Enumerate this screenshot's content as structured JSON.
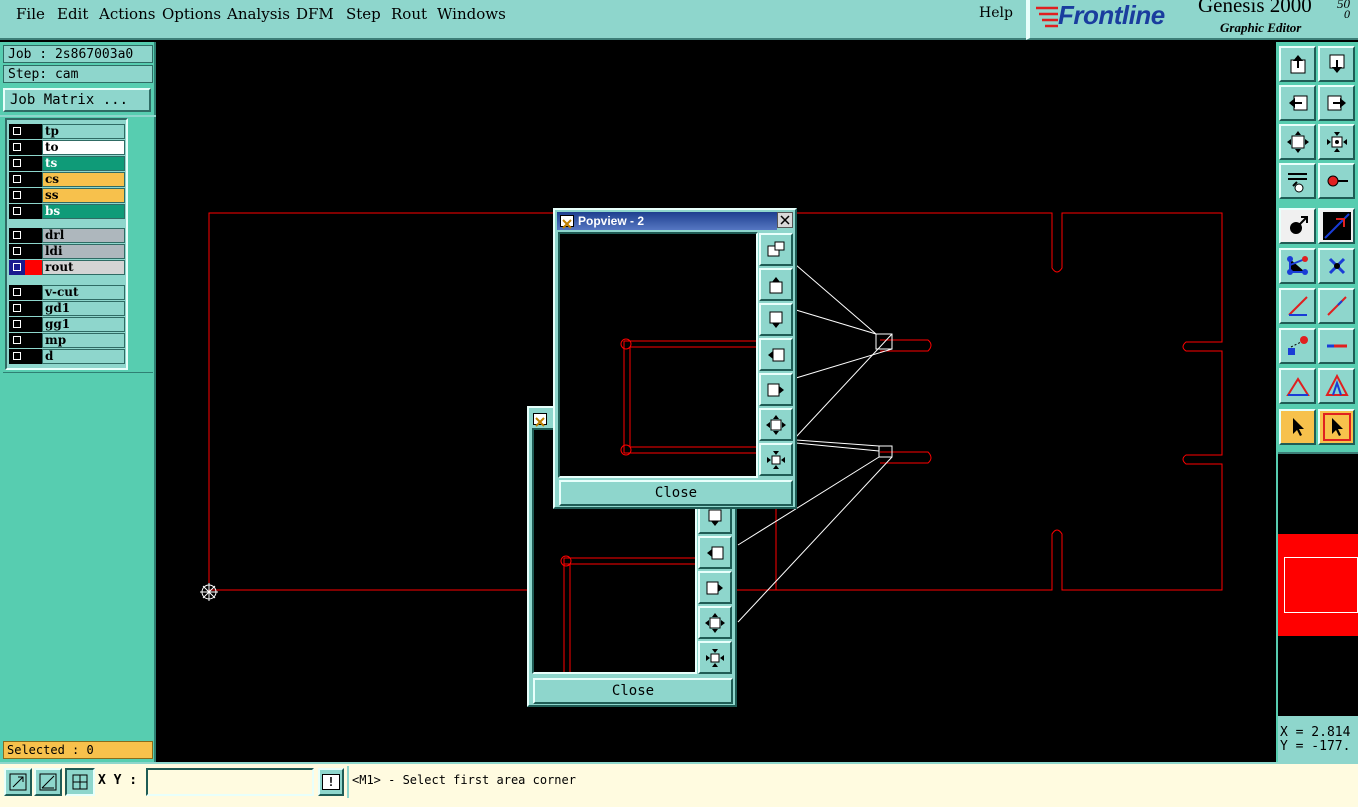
{
  "menu": {
    "items": [
      "File",
      "Edit",
      "Actions",
      "Options",
      "Analysis",
      "DFM",
      "Step",
      "Rout",
      "Windows"
    ],
    "help": "Help"
  },
  "brand": {
    "logo": "Frontline",
    "product": "Genesis 2000",
    "superscript": "50",
    "subtitle": "Graphic Editor",
    "corner": "0"
  },
  "left": {
    "job": "Job : 2s867003a0",
    "step": "Step: cam",
    "job_matrix": "Job Matrix ...",
    "layers": [
      {
        "name": "tp",
        "color": "#8ed6cc",
        "swatch": "#000000"
      },
      {
        "name": "to",
        "color": "#ffffff",
        "swatch": "#000000"
      },
      {
        "name": "ts",
        "color": "#0f9b78",
        "swatch": "#000000"
      },
      {
        "name": "cs",
        "color": "#f7c14c",
        "swatch": "#000000"
      },
      {
        "name": "ss",
        "color": "#f7c14c",
        "swatch": "#000000"
      },
      {
        "name": "bs",
        "color": "#0f9b78",
        "swatch": "#000000"
      },
      {
        "name": "drl",
        "color": "#aeb7bd",
        "swatch": "#000000"
      },
      {
        "name": "ldi",
        "color": "#aeb7bd",
        "swatch": "#000000"
      },
      {
        "name": "rout",
        "color": "#d4d4d4",
        "swatch": "#ff0000"
      },
      {
        "name": "v-cut",
        "color": "#8ed6cc",
        "swatch": "#000000"
      },
      {
        "name": "gd1",
        "color": "#8ed6cc",
        "swatch": "#000000"
      },
      {
        "name": "gg1",
        "color": "#8ed6cc",
        "swatch": "#000000"
      },
      {
        "name": "mp",
        "color": "#8ed6cc",
        "swatch": "#000000"
      },
      {
        "name": "d",
        "color": "#8ed6cc",
        "swatch": "#000000"
      }
    ],
    "selected": "Selected : 0"
  },
  "coords": {
    "x": "X = 2.814",
    "y": "Y = -177."
  },
  "bottom": {
    "xy_label": "X Y :",
    "xy_value": "",
    "alert": "!",
    "prompt": "<M1> - Select first area corner"
  },
  "popview_front": {
    "title": "Popview - 2",
    "close": "Close"
  },
  "popview_back": {
    "close": "Close"
  },
  "colors": {
    "rout": "#ff0000",
    "panel": "#57cdb0",
    "control": "#8ed6cc",
    "selected": "#f7c14c"
  }
}
